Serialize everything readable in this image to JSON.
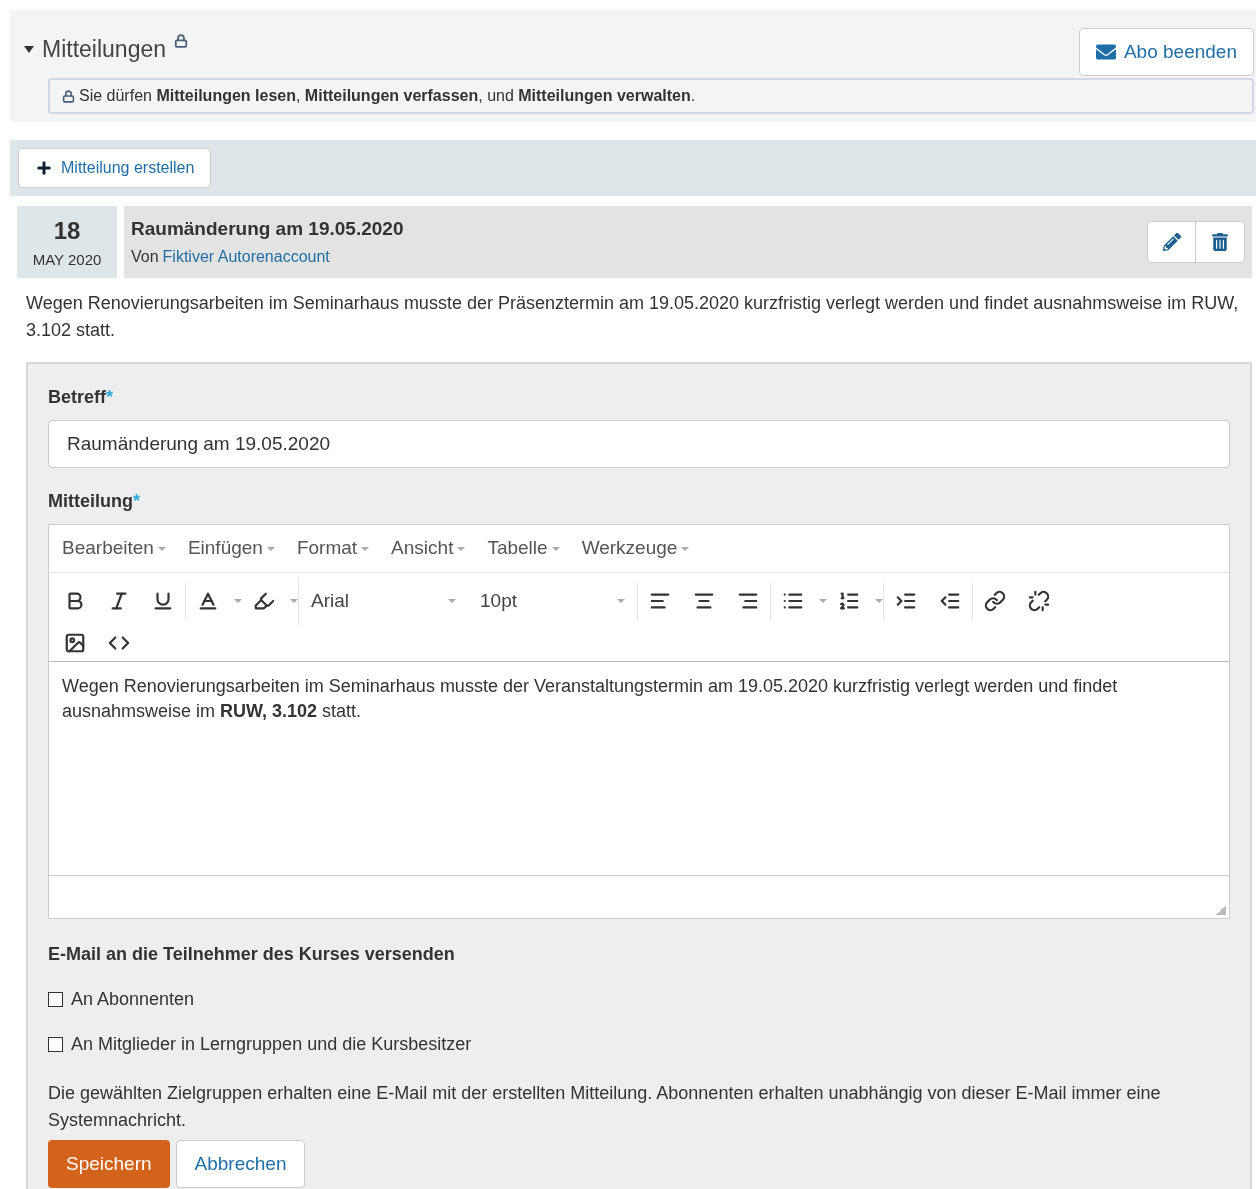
{
  "section": {
    "title": "Mitteilungen",
    "expanded": true,
    "subscribe_button": "Abo beenden",
    "permissions": "Sie dürfen **Mitteilungen lesen**, **Mitteilungen verfassen**, und **Mitteilungen verwalten**."
  },
  "create_button": "Mitteilung erstellen",
  "post": {
    "day": "18",
    "month_year": "MAY 2020",
    "title": "Raumänderung am 19.05.2020",
    "by": "Von",
    "author": "Fiktiver Autorenaccount",
    "body": "Wegen Renovierungsarbeiten im Seminarhaus musste der Präsenztermin am 19.05.2020 kurzfristig verlegt werden und findet ausnahmsweise im RUW, 3.102 statt."
  },
  "form": {
    "subject_label": "Betreff",
    "required_mark": "*",
    "subject_value": "Raumänderung am 19.05.2020",
    "message_label": "Mitteilung",
    "menu": [
      "Bearbeiten",
      "Einfügen",
      "Format",
      "Ansicht",
      "Tabelle",
      "Werkzeuge"
    ],
    "font": "Arial",
    "size": "10pt",
    "content": "Wegen Renovierungsarbeiten im Seminarhaus musste der Veranstaltungstermin am 19.05.2020 kurzfristig verlegt werden und findet ausnahmsweise im **RUW, 3.102** statt.",
    "email_heading": "E-Mail an die Teilnehmer des Kurses versenden",
    "recipients": [
      {
        "label": "An Abonnenten",
        "checked": false
      },
      {
        "label": "An Mitglieder in Lerngruppen und die Kursbesitzer",
        "checked": false
      }
    ],
    "note": "Die gewählten Zielgruppen erhalten eine E-Mail mit der erstellten Mitteilung. Abonnenten erhalten unabhängig von dieser E-Mail immer eine Systemnachricht.",
    "save_button": "Speichern",
    "cancel_button": "Abbrechen"
  }
}
